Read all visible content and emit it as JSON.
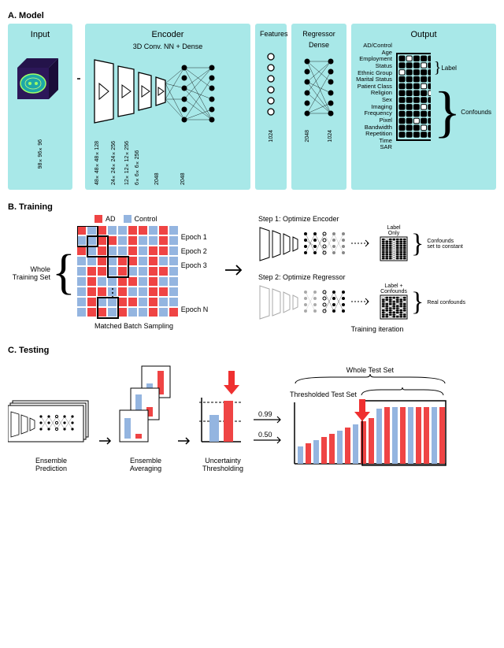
{
  "sectionA": {
    "label": "A. Model"
  },
  "sectionB": {
    "label": "B. Training"
  },
  "sectionC": {
    "label": "C. Testing"
  },
  "panelA": {
    "input_title": "Input",
    "encoder_title": "Encoder",
    "features_title": "Features",
    "regressor_title": "Regressor",
    "output_title": "Output",
    "encoder_sub": "3D Conv. NN + Dense",
    "regressor_sub": "Dense",
    "dims": {
      "input": "98×96×96",
      "c1": "48×48×48×128",
      "c2": "24×24×24×256",
      "c3": "12×12×12×256",
      "c4": "6×6×6×256",
      "d1": "2048",
      "d2": "2048",
      "feat": "1024",
      "r1": "2048",
      "r2": "1024"
    },
    "outputs": [
      "AD/Control",
      "Age",
      "Employment Status",
      "Ethnic Group",
      "Marital Status",
      "Patient Class",
      "Religion",
      "Sex",
      "Imaging Frequency",
      "Pixel Bandwidth",
      "Repetition Time",
      "SAR"
    ],
    "label_text": "Label",
    "confounds_text": "Confounds"
  },
  "panelB": {
    "legend_ad": "AD",
    "legend_control": "Control",
    "epochs": [
      "Epoch 1",
      "Epoch 2",
      "Epoch 3",
      "Epoch N"
    ],
    "whole_training": "Whole\nTraining Set",
    "matched": "Matched Batch\nSampling",
    "step1": "Step 1: Optimize Encoder",
    "step2": "Step 2: Optimize Regressor",
    "label_only": "Label\nOnly",
    "confounds_const": "Confounds\nset to constant",
    "label_conf": "Label +\nConfounds",
    "real_conf": "Real confounds",
    "iter": "Training iteration"
  },
  "panelC": {
    "whole_test": "Whole Test Set",
    "thresh_test": "Thresholded Test Set",
    "ensemble_pred": "Ensemble\nPrediction",
    "ensemble_avg": "Ensemble\nAveraging",
    "uncertainty": "Uncertainty\nThresholding",
    "th_high": "0.99",
    "th_low": "0.50"
  }
}
